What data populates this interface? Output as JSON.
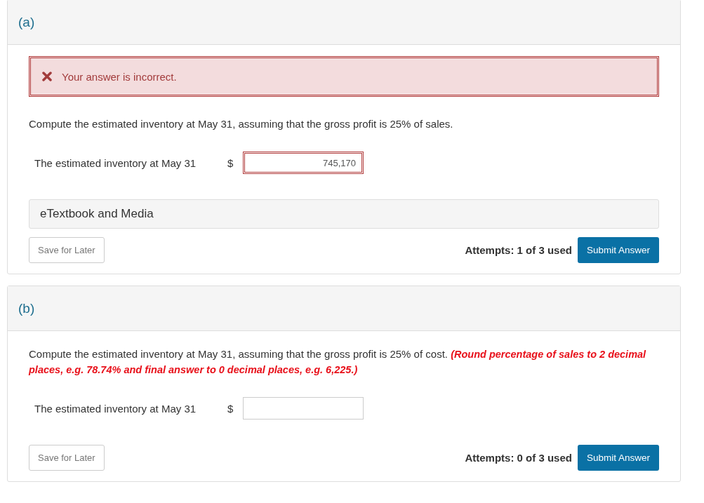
{
  "parts": [
    {
      "label": "(a)",
      "feedback": {
        "kind": "incorrect",
        "text": "Your answer is incorrect."
      },
      "question": "Compute the estimated inventory at May 31, assuming that the gross profit is 25% of sales.",
      "answer": {
        "label": "The estimated inventory at May 31",
        "currency": "$",
        "value": "745,170",
        "incorrect": true
      },
      "etextbook": "eTextbook and Media",
      "save": "Save for Later",
      "attempts": "Attempts: 1 of 3 used",
      "submit": "Submit Answer"
    },
    {
      "label": "(b)",
      "question": "Compute the estimated inventory at May 31, assuming that the gross profit is 25% of cost.",
      "instruction": "(Round percentage of sales to 2 decimal places, e.g. 78.74% and final answer to 0 decimal places, e.g. 6,225.)",
      "answer": {
        "label": "The estimated inventory at May 31",
        "currency": "$",
        "incorrect": false
      },
      "save": "Save for Later",
      "attempts": "Attempts: 0 of 3 used",
      "submit": "Submit Answer"
    }
  ]
}
